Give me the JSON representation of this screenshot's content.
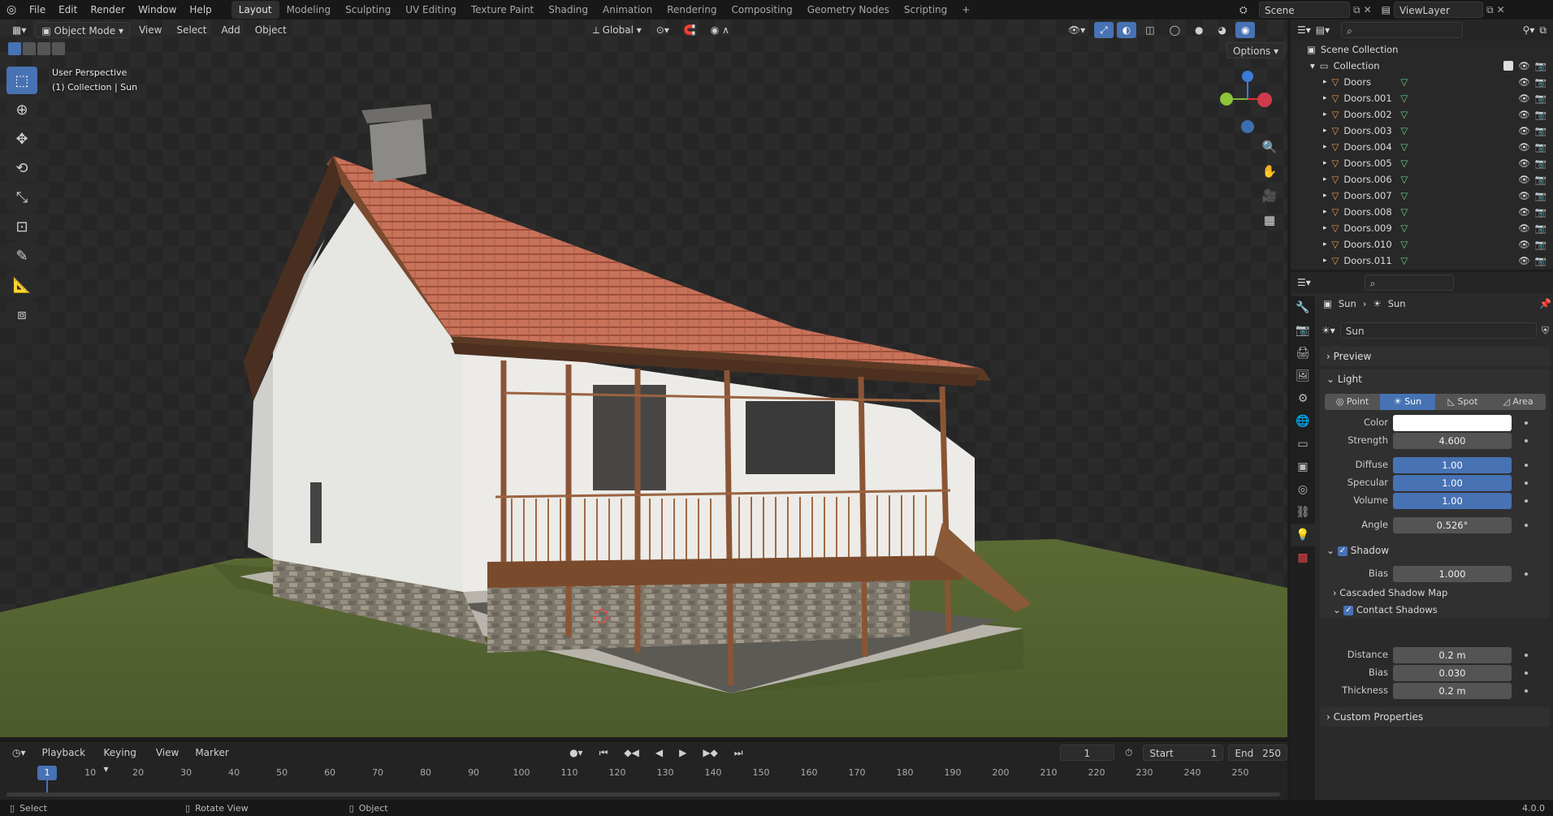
{
  "menu": [
    "File",
    "Edit",
    "Render",
    "Window",
    "Help"
  ],
  "workspaces": [
    "Layout",
    "Modeling",
    "Sculpting",
    "UV Editing",
    "Texture Paint",
    "Shading",
    "Animation",
    "Rendering",
    "Compositing",
    "Geometry Nodes",
    "Scripting",
    "+"
  ],
  "scene": "Scene",
  "view_layer": "ViewLayer",
  "viewport": {
    "mode": "Object Mode",
    "menus": [
      "View",
      "Select",
      "Add",
      "Object"
    ],
    "transform_orientation": "Global",
    "options_label": "Options",
    "perspective_label": "User Perspective",
    "collection_label": "(1) Collection | Sun"
  },
  "timeline": {
    "menus": [
      "Playback",
      "Keying",
      "View",
      "Marker"
    ],
    "current_frame": "1",
    "start_label": "Start",
    "start": "1",
    "end_label": "End",
    "end": "250",
    "ruler": [
      "1",
      "10",
      "20",
      "30",
      "40",
      "50",
      "60",
      "70",
      "80",
      "90",
      "100",
      "110",
      "120",
      "130",
      "140",
      "150",
      "160",
      "170",
      "180",
      "190",
      "200",
      "210",
      "220",
      "230",
      "240",
      "250"
    ]
  },
  "statusbar": {
    "select": "Select",
    "rotate": "Rotate View",
    "object": "Object",
    "version": "4.0.0"
  },
  "outliner": {
    "scene_collection": "Scene Collection",
    "collection": "Collection",
    "items": [
      "Doors",
      "Doors.001",
      "Doors.002",
      "Doors.003",
      "Doors.004",
      "Doors.005",
      "Doors.006",
      "Doors.007",
      "Doors.008",
      "Doors.009",
      "Doors.010",
      "Doors.011"
    ]
  },
  "properties": {
    "breadcrumb_object": "Sun",
    "breadcrumb_data": "Sun",
    "data_name": "Sun",
    "preview": "Preview",
    "light_panel": "Light",
    "light_types": [
      "Point",
      "Sun",
      "Spot",
      "Area"
    ],
    "active_light_type": "Sun",
    "fields": {
      "color_label": "Color",
      "strength_label": "Strength",
      "strength": "4.600",
      "diffuse_label": "Diffuse",
      "diffuse": "1.00",
      "specular_label": "Specular",
      "specular": "1.00",
      "volume_label": "Volume",
      "volume": "1.00",
      "angle_label": "Angle",
      "angle": "0.526°"
    },
    "shadow_panel": "Shadow",
    "shadow_bias_label": "Bias",
    "shadow_bias": "1.000",
    "cascaded": "Cascaded Shadow Map",
    "contact": "Contact Shadows",
    "contact_fields": {
      "distance_label": "Distance",
      "distance": "0.2 m",
      "bias_label": "Bias",
      "bias": "0.030",
      "thickness_label": "Thickness",
      "thickness": "0.2 m"
    },
    "custom_props": "Custom Properties"
  },
  "colors": {
    "accent": "#4772b3",
    "light_color": "#ffffff"
  }
}
